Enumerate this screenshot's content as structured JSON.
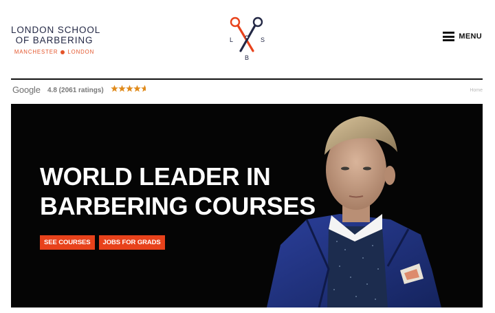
{
  "brand": {
    "line1": "LONDON SCHOOL",
    "line2": "OF BARBERING",
    "sub_left": "MANCHESTER",
    "sub_right": "LONDON"
  },
  "logo": {
    "letters": {
      "left": "L",
      "right": "S",
      "bottom": "B"
    }
  },
  "nav": {
    "menu_label": "MENU",
    "menu_icon": "hamburger-icon"
  },
  "rating": {
    "provider": "Google",
    "score_text": "4.8 (2061 ratings)",
    "score": 4.8,
    "stars_max": 5,
    "stars_glyphs": "★★★★★"
  },
  "breadcrumb": {
    "home": "Home"
  },
  "hero": {
    "headline_line1": "WORLD LEADER IN",
    "headline_line2": "BARBERING COURSES",
    "cta_primary": "SEE COURSES",
    "cta_secondary": "JOBS FOR GRADS"
  },
  "colors": {
    "accent": "#e8421b",
    "brand_navy": "#232845",
    "star": "#e08a1a",
    "hero_bg": "#050505"
  }
}
